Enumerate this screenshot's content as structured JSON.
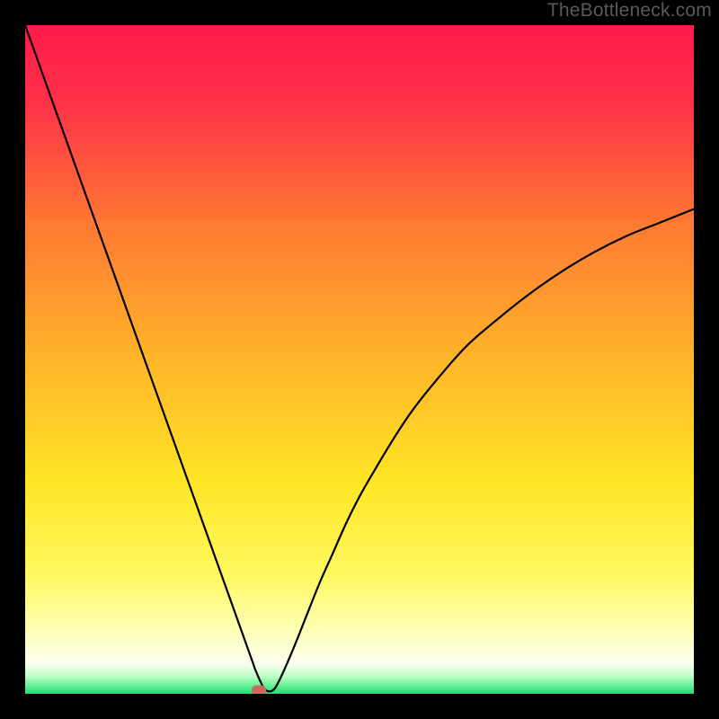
{
  "watermark": "TheBottleneck.com",
  "chart_data": {
    "type": "line",
    "title": "",
    "xlabel": "",
    "ylabel": "",
    "xlim": [
      0,
      100
    ],
    "ylim": [
      0,
      100
    ],
    "gradient_stops": [
      {
        "pos": 0.0,
        "color": "#ff1a4a"
      },
      {
        "pos": 0.12,
        "color": "#ff3348"
      },
      {
        "pos": 0.3,
        "color": "#ff7a33"
      },
      {
        "pos": 0.5,
        "color": "#ffb52a"
      },
      {
        "pos": 0.68,
        "color": "#ffe425"
      },
      {
        "pos": 0.82,
        "color": "#fff85e"
      },
      {
        "pos": 0.9,
        "color": "#ffffb0"
      },
      {
        "pos": 0.955,
        "color": "#fafff0"
      },
      {
        "pos": 0.975,
        "color": "#b8ffc4"
      },
      {
        "pos": 1.0,
        "color": "#18e06a"
      }
    ],
    "series": [
      {
        "name": "bottleneck-curve",
        "x": [
          0.0,
          2,
          4,
          6,
          8,
          10,
          12,
          14,
          16,
          18,
          20,
          22,
          24,
          26,
          28,
          30,
          31,
          32,
          33,
          34,
          34.5,
          35.5,
          36,
          37,
          38,
          40,
          42,
          44,
          46,
          48,
          50,
          52,
          55,
          58,
          62,
          66,
          70,
          75,
          80,
          85,
          90,
          95,
          100
        ],
        "y": [
          100,
          94.4,
          88.8,
          83.2,
          77.6,
          72.0,
          66.4,
          60.8,
          55.2,
          49.6,
          44.0,
          38.4,
          32.8,
          27.2,
          21.6,
          16.0,
          13.2,
          10.4,
          7.6,
          4.8,
          3.4,
          1.2,
          0.5,
          0.5,
          2.0,
          6.5,
          11.5,
          16.5,
          21.0,
          25.5,
          29.5,
          33.0,
          38.0,
          42.5,
          47.5,
          52.0,
          55.5,
          59.5,
          63.0,
          66.0,
          68.5,
          70.5,
          72.5
        ]
      }
    ],
    "marker": {
      "x": 35.0,
      "y": 0.5,
      "color": "#c96a5e"
    }
  }
}
